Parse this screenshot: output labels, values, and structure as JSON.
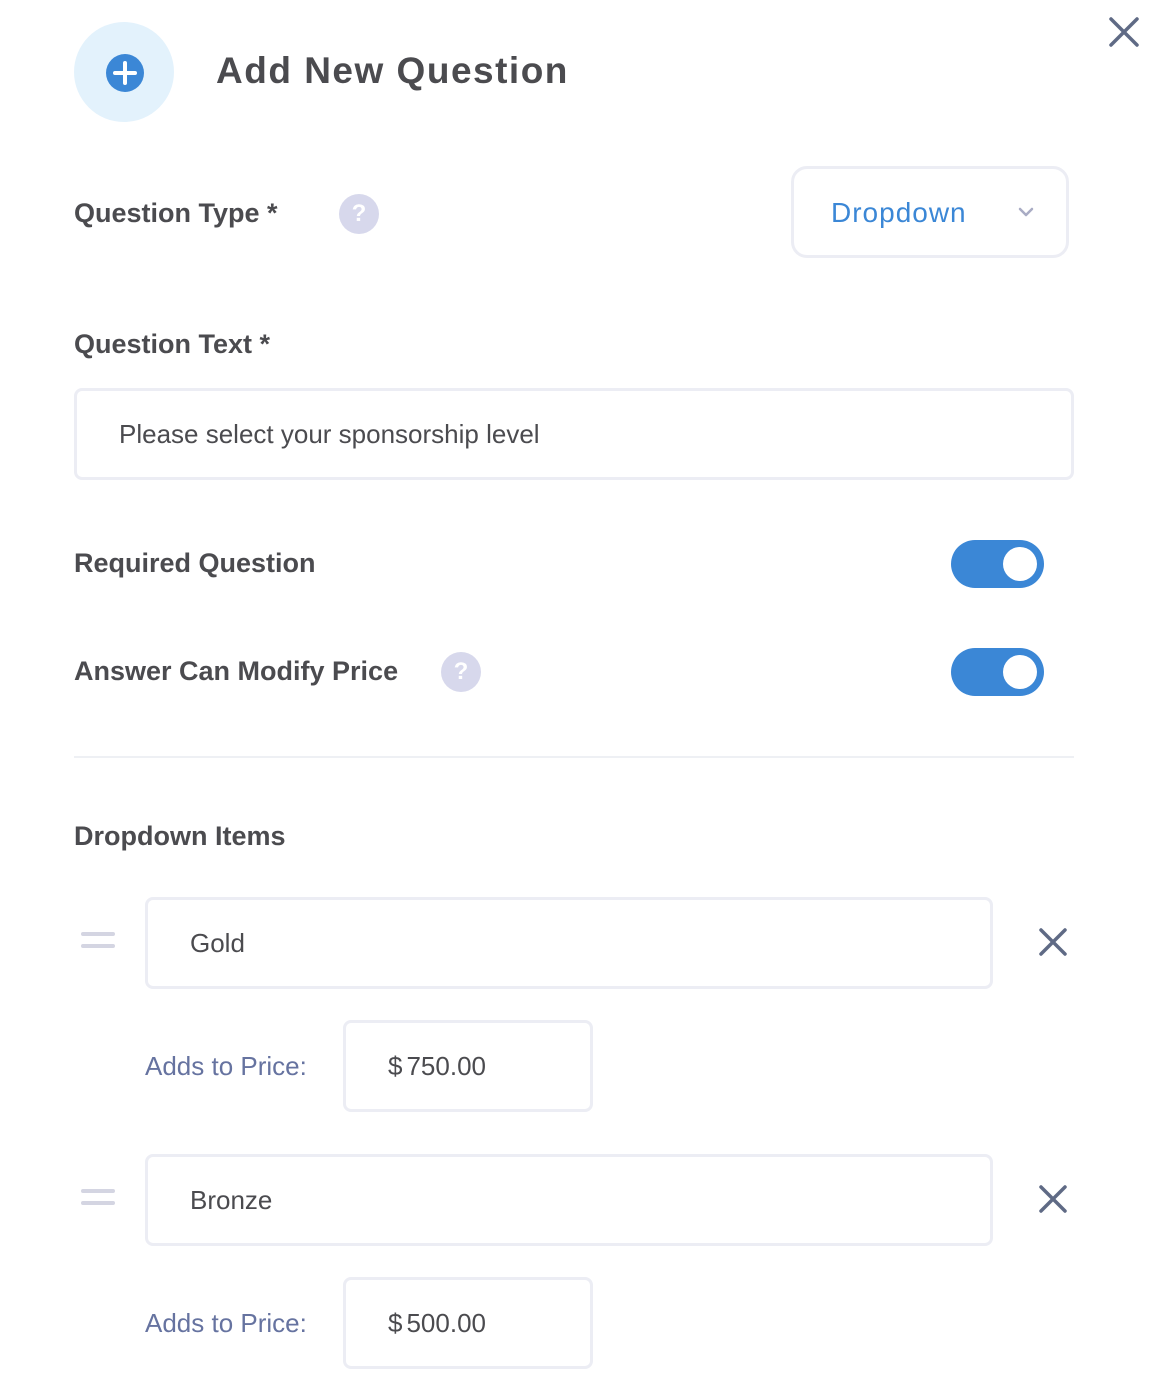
{
  "modal": {
    "title": "Add New Question"
  },
  "question_type": {
    "label": "Question Type *",
    "help": "?",
    "selected": "Dropdown"
  },
  "question_text": {
    "label": "Question Text *",
    "value": "Please select your sponsorship level"
  },
  "required_question": {
    "label": "Required Question",
    "enabled": true
  },
  "modify_price": {
    "label": "Answer Can Modify Price",
    "help": "?",
    "enabled": true
  },
  "dropdown_items": {
    "label": "Dropdown Items",
    "items": [
      {
        "name": "Gold",
        "price_label": "Adds to Price:",
        "currency": "$",
        "price": "750.00"
      },
      {
        "name": "Bronze",
        "price_label": "Adds to Price:",
        "currency": "$",
        "price": "500.00"
      }
    ]
  },
  "colors": {
    "accent": "#3b87d6",
    "header_circle": "#e3f2fc",
    "help_bubble": "#d7d8ec",
    "price_label": "#6673a0"
  },
  "icons": {
    "header": "plus-circle-icon",
    "close": "close-icon",
    "help": "question-mark-icon",
    "select": "chevron-down-icon",
    "drag": "drag-handle-icon",
    "remove": "close-icon"
  }
}
